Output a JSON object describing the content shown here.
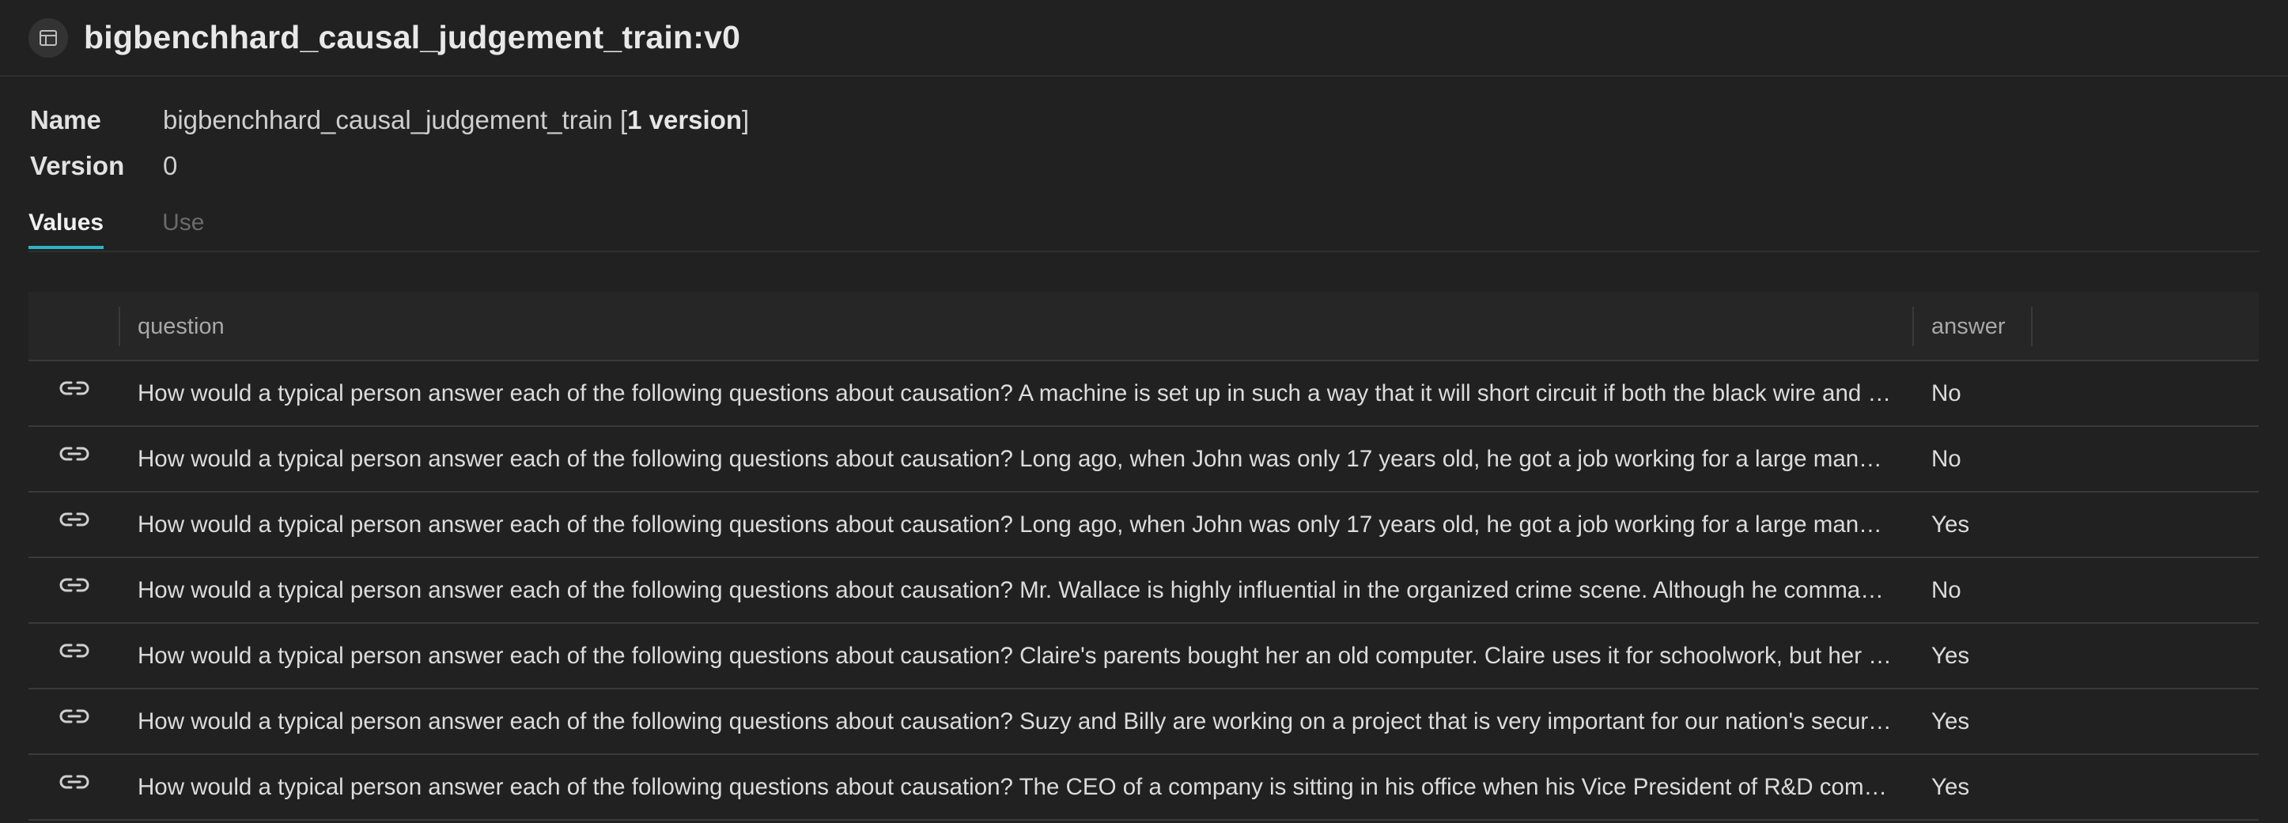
{
  "header": {
    "title": "bigbenchhard_causal_judgement_train:v0",
    "icon": "table-icon"
  },
  "meta": {
    "name_label": "Name",
    "name_value": "bigbenchhard_causal_judgement_train",
    "version_count_open": "[",
    "version_count": "1 version",
    "version_count_close": "]",
    "version_label": "Version",
    "version_value": "0"
  },
  "tabs": [
    {
      "label": "Values",
      "active": true
    },
    {
      "label": "Use",
      "active": false
    }
  ],
  "table": {
    "columns": [
      "question",
      "answer"
    ],
    "rows": [
      {
        "question": "How would a typical person answer each of the following questions about causation? A machine is set up in such a way that it will short circuit if both the black wire and the red wire touch the battery at the same time.",
        "answer": "No"
      },
      {
        "question": "How would a typical person answer each of the following questions about causation? Long ago, when John was only 17 years old, he got a job working for a large manufacturing company.",
        "answer": "No"
      },
      {
        "question": "How would a typical person answer each of the following questions about causation? Long ago, when John was only 17 years old, he got a job working for a large manufacturing company.",
        "answer": "Yes"
      },
      {
        "question": "How would a typical person answer each of the following questions about causation? Mr. Wallace is highly influential in the organized crime scene. Although he commands the respect of many.",
        "answer": "No"
      },
      {
        "question": "How would a typical person answer each of the following questions about causation? Claire's parents bought her an old computer. Claire uses it for schoolwork, but her brother Daniel sometimes logs on.",
        "answer": "Yes"
      },
      {
        "question": "How would a typical person answer each of the following questions about causation? Suzy and Billy are working on a project that is very important for our nation's security.",
        "answer": "Yes"
      },
      {
        "question": "How would a typical person answer each of the following questions about causation? The CEO of a company is sitting in his office when his Vice President of R&D comes in and says.",
        "answer": "Yes"
      }
    ]
  },
  "colors": {
    "background": "#212121",
    "accent": "#2fb3c3"
  }
}
